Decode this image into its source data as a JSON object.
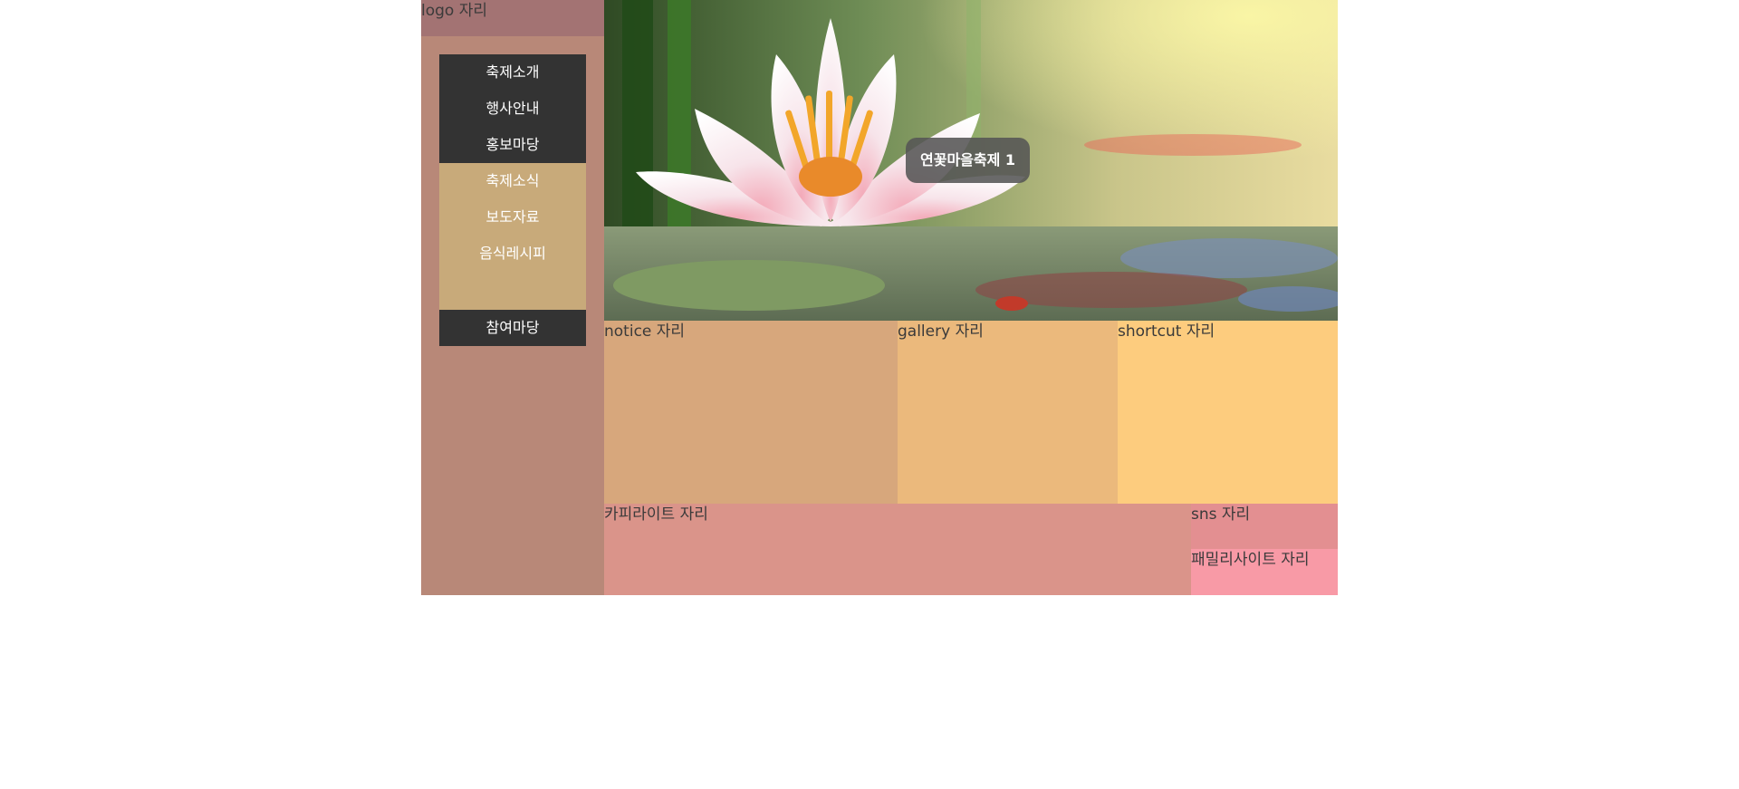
{
  "header": {
    "logo": "logo 자리"
  },
  "nav": {
    "items": [
      {
        "label": "축제소개"
      },
      {
        "label": "행사안내"
      },
      {
        "label": "홍보마당"
      }
    ],
    "sub_items": [
      {
        "label": "축제소식"
      },
      {
        "label": "보도자료"
      },
      {
        "label": "음식레시피"
      }
    ],
    "last_item": {
      "label": "참여마당"
    }
  },
  "hero": {
    "caption": "연꽃마을축제 1",
    "image": "lotus-flower-photo"
  },
  "sections": {
    "notice": "notice 자리",
    "gallery": "gallery 자리",
    "shortcut": "shortcut 자리"
  },
  "footer": {
    "copyright": "카피라이트 자리",
    "sns": "sns 자리",
    "family_site": "패밀리사이트 자리"
  },
  "colors": {
    "sidebar": "#b88878",
    "nav_dark": "#333333",
    "nav_sub": "#c8aa7a",
    "notice": "#d7a77c",
    "gallery": "#ebb97c",
    "shortcut": "#fdcc7e",
    "copyright": "#da948a",
    "sns": "#e38f91",
    "family_site": "#f89aa6"
  }
}
